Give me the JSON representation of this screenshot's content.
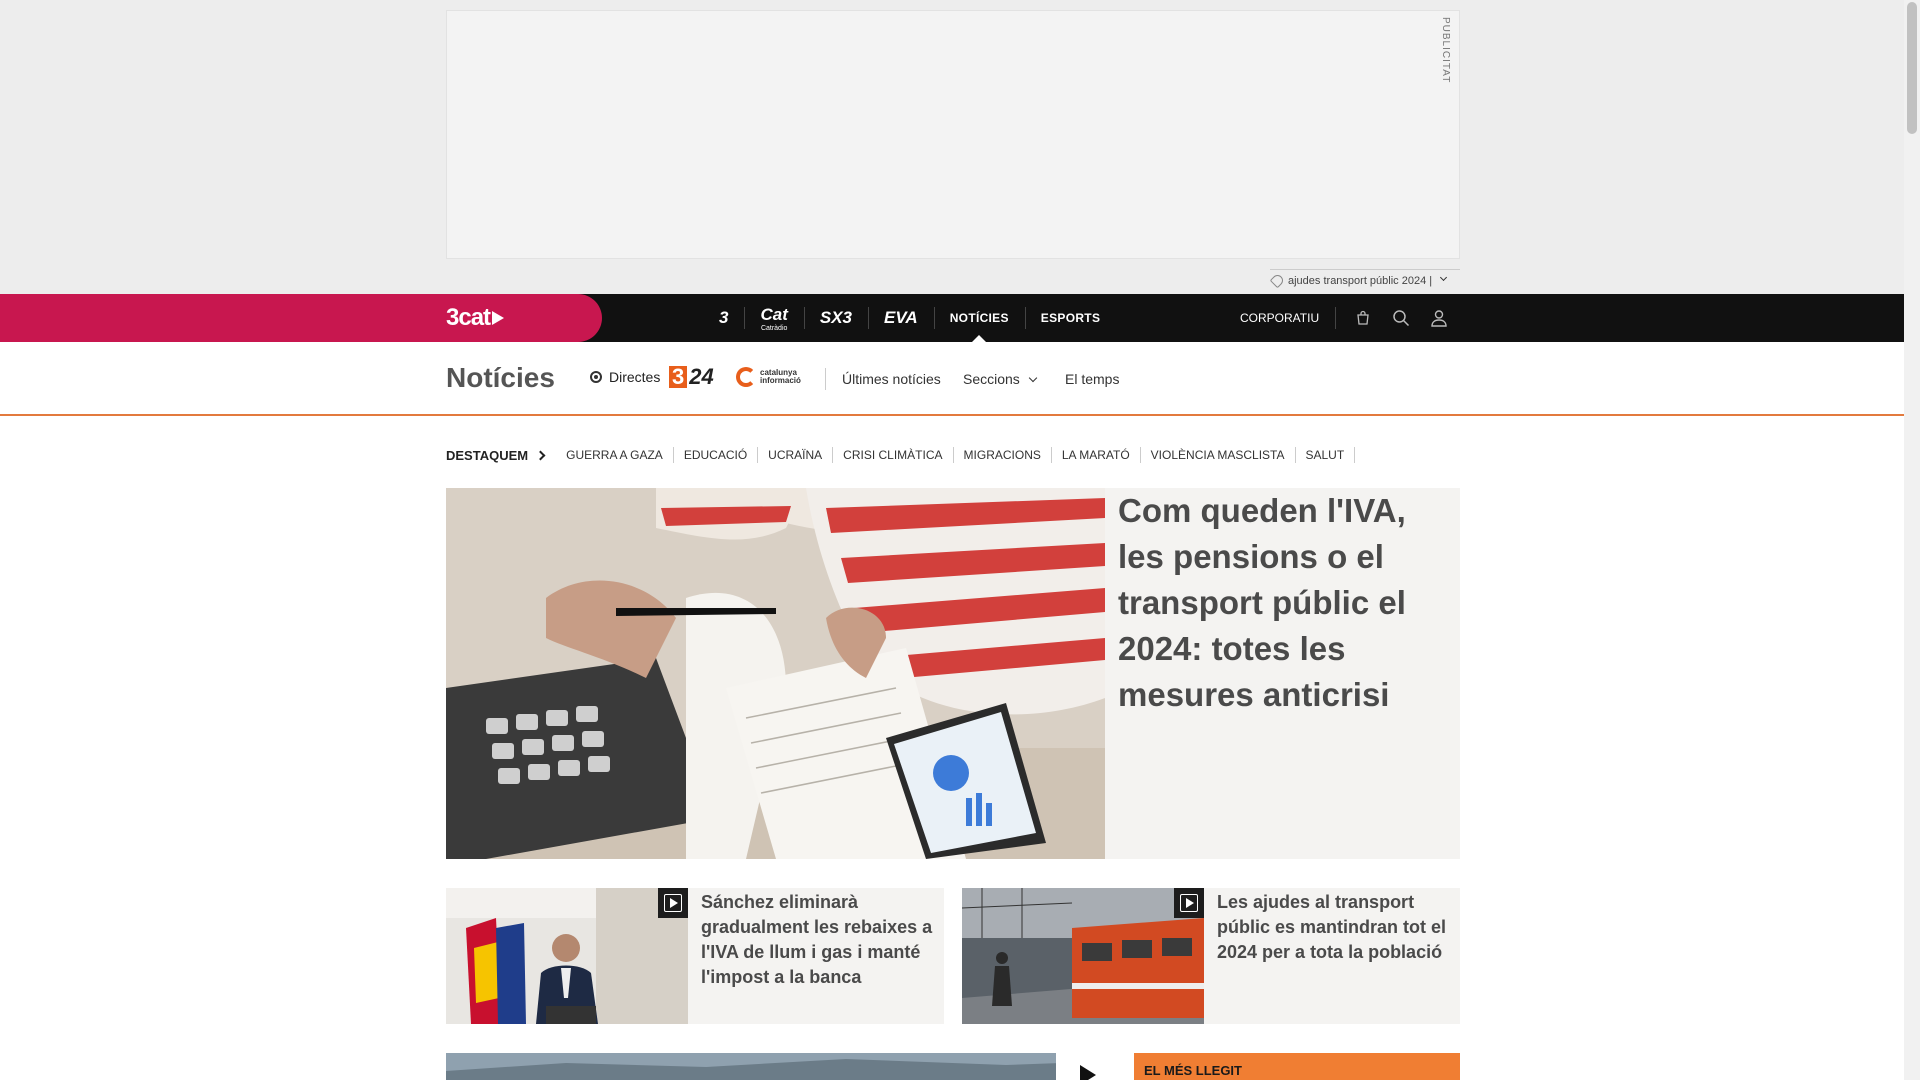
{
  "ad": {
    "label": "PUBLICITAT",
    "sub_label": "ajudes transport públic 2024 |"
  },
  "topnav": {
    "brand": "3cat",
    "channels": [
      {
        "label": "3",
        "name": "tv3"
      },
      {
        "label": "Cat",
        "sub": "Catràdio",
        "name": "catradio"
      },
      {
        "label": "SX3",
        "name": "sx3"
      },
      {
        "label": "EVA",
        "name": "eva"
      },
      {
        "label": "NOTÍCIES",
        "name": "noticies",
        "active": true
      },
      {
        "label": "ESPORTS",
        "name": "esports"
      }
    ],
    "corporate": "CORPORATIU",
    "icons": [
      "shopping-bag-icon",
      "search-icon",
      "user-icon"
    ]
  },
  "secnav": {
    "title": "Notícies",
    "directes": "Directes",
    "logo_324_a": "3",
    "logo_324_b": "24",
    "logo_ci_line1": "catalunya",
    "logo_ci_line2": "informació",
    "links": [
      "Últimes notícies",
      "Seccions",
      "El temps"
    ]
  },
  "tags": {
    "label": "DESTAQUEM",
    "items": [
      "GUERRA A GAZA",
      "EDUCACIÓ",
      "UCRAÏNA",
      "CRISI CLIMÀTICA",
      "MIGRACIONS",
      "LA MARATÓ",
      "VIOLÈNCIA MASCLISTA",
      "SALUT"
    ]
  },
  "hero": {
    "title": "Com queden l'IVA, les pensions o el transport públic el 2024: totes les mesures anticrisi"
  },
  "cards": [
    {
      "title": "Sánchez eliminarà gradualment les rebaixes a l'IVA de llum i gas i manté l'impost a la banca"
    },
    {
      "title": "Les ajudes al transport públic es mantindran tot el 2024 per a tota la població"
    }
  ],
  "sidebar": {
    "most_read": "EL MÉS LLEGIT"
  }
}
